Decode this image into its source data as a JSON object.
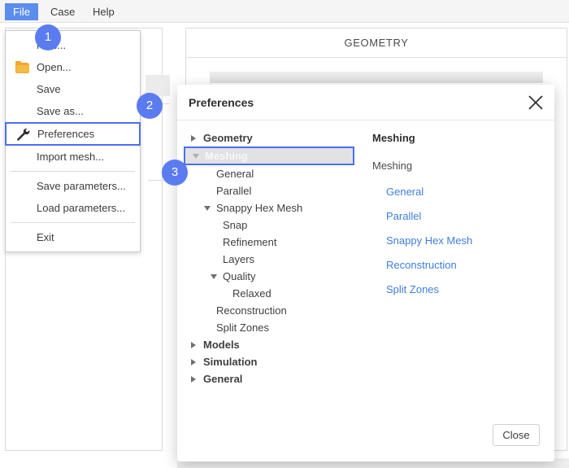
{
  "menubar": {
    "items": [
      {
        "label": "File",
        "active": true
      },
      {
        "label": "Case",
        "active": false
      },
      {
        "label": "Help",
        "active": false
      }
    ]
  },
  "background": {
    "panel_header": "GEOMETRY"
  },
  "file_menu": {
    "items": [
      {
        "label": "New...",
        "icon": "none",
        "highlighted": false,
        "obscured_by_badge": true
      },
      {
        "label": "Open...",
        "icon": "folder-icon",
        "highlighted": false
      },
      {
        "label": "Save",
        "icon": "none",
        "highlighted": false
      },
      {
        "label": "Save as...",
        "icon": "none",
        "highlighted": false
      },
      {
        "label": "Preferences",
        "icon": "wrench-icon",
        "highlighted": true
      },
      {
        "label": "Import mesh...",
        "icon": "none",
        "highlighted": false
      },
      {
        "label": "Save parameters...",
        "icon": "none",
        "highlighted": false
      },
      {
        "label": "Load parameters...",
        "icon": "none",
        "highlighted": false
      },
      {
        "label": "Exit",
        "icon": "none",
        "highlighted": false
      }
    ]
  },
  "dialog": {
    "title": "Preferences",
    "close_icon": "close-icon",
    "tree": [
      {
        "label": "Geometry",
        "level": 0,
        "twisty": "right",
        "selected": false
      },
      {
        "label": "Meshing",
        "level": 0,
        "twisty": "down",
        "selected": true
      },
      {
        "label": "General",
        "level": 1,
        "twisty": "none",
        "selected": false
      },
      {
        "label": "Parallel",
        "level": 1,
        "twisty": "none",
        "selected": false
      },
      {
        "label": "Snappy Hex Mesh",
        "level": 1,
        "twisty": "down",
        "selected": false
      },
      {
        "label": "Snap",
        "level": 2,
        "twisty": "none",
        "selected": false
      },
      {
        "label": "Refinement",
        "level": 2,
        "twisty": "none",
        "selected": false
      },
      {
        "label": "Layers",
        "level": 2,
        "twisty": "none",
        "selected": false
      },
      {
        "label": "Quality",
        "level": 2,
        "twisty": "down",
        "selected": false
      },
      {
        "label": "Relaxed",
        "level": 3,
        "twisty": "none",
        "selected": false
      },
      {
        "label": "Reconstruction",
        "level": 1,
        "twisty": "none",
        "selected": false
      },
      {
        "label": "Split Zones",
        "level": 1,
        "twisty": "none",
        "selected": false
      },
      {
        "label": "Models",
        "level": 0,
        "twisty": "right",
        "selected": false
      },
      {
        "label": "Simulation",
        "level": 0,
        "twisty": "right",
        "selected": false
      },
      {
        "label": "General",
        "level": 0,
        "twisty": "right",
        "selected": false
      }
    ],
    "detail": {
      "heading": "Meshing",
      "subtitle": "Meshing",
      "links": [
        "General",
        "Parallel",
        "Snappy Hex Mesh",
        "Reconstruction",
        "Split Zones"
      ]
    },
    "close_button": "Close"
  },
  "badges": [
    {
      "number": "1"
    },
    {
      "number": "2"
    },
    {
      "number": "3"
    }
  ],
  "colors": {
    "accent_blue": "#5b7cf0",
    "menu_active_blue": "#5b8dee",
    "highlight_border": "#4a6ef5",
    "link_blue": "#3d7fdc",
    "folder_orange": "#f0a830"
  }
}
